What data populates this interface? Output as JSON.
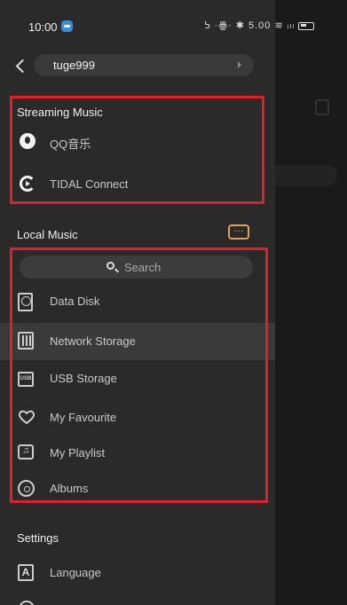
{
  "status_bar": {
    "time": "10:00",
    "icons_text": "ᕊ ·ꙮ· ✱ 5.00 ≋ ᵢₗₗ"
  },
  "account": {
    "name": "tuge999"
  },
  "streaming": {
    "title": "Streaming Music",
    "items": [
      {
        "label": "QQ音乐",
        "icon": "qq-music-icon"
      },
      {
        "label": "TIDAL Connect",
        "icon": "tidal-icon"
      }
    ]
  },
  "local": {
    "title": "Local Music",
    "search_placeholder": "Search",
    "items": [
      {
        "label": "Data Disk",
        "icon": "disk-icon"
      },
      {
        "label": "Network Storage",
        "icon": "network-storage-icon",
        "selected": true
      },
      {
        "label": "USB Storage",
        "icon": "usb-icon",
        "icon_text": "USB"
      },
      {
        "label": "My Favourite",
        "icon": "heart-icon"
      },
      {
        "label": "My Playlist",
        "icon": "playlist-icon"
      },
      {
        "label": "Albums",
        "icon": "album-icon"
      }
    ]
  },
  "settings": {
    "title": "Settings",
    "items": [
      {
        "label": "Language",
        "icon": "language-icon",
        "icon_text": "A"
      }
    ]
  },
  "colors": {
    "drawer_bg": "#2a2a2a",
    "selected_bg": "#3a3a3a",
    "highlight_border": "#e3202a",
    "accent_orange": "#e0a24a"
  }
}
